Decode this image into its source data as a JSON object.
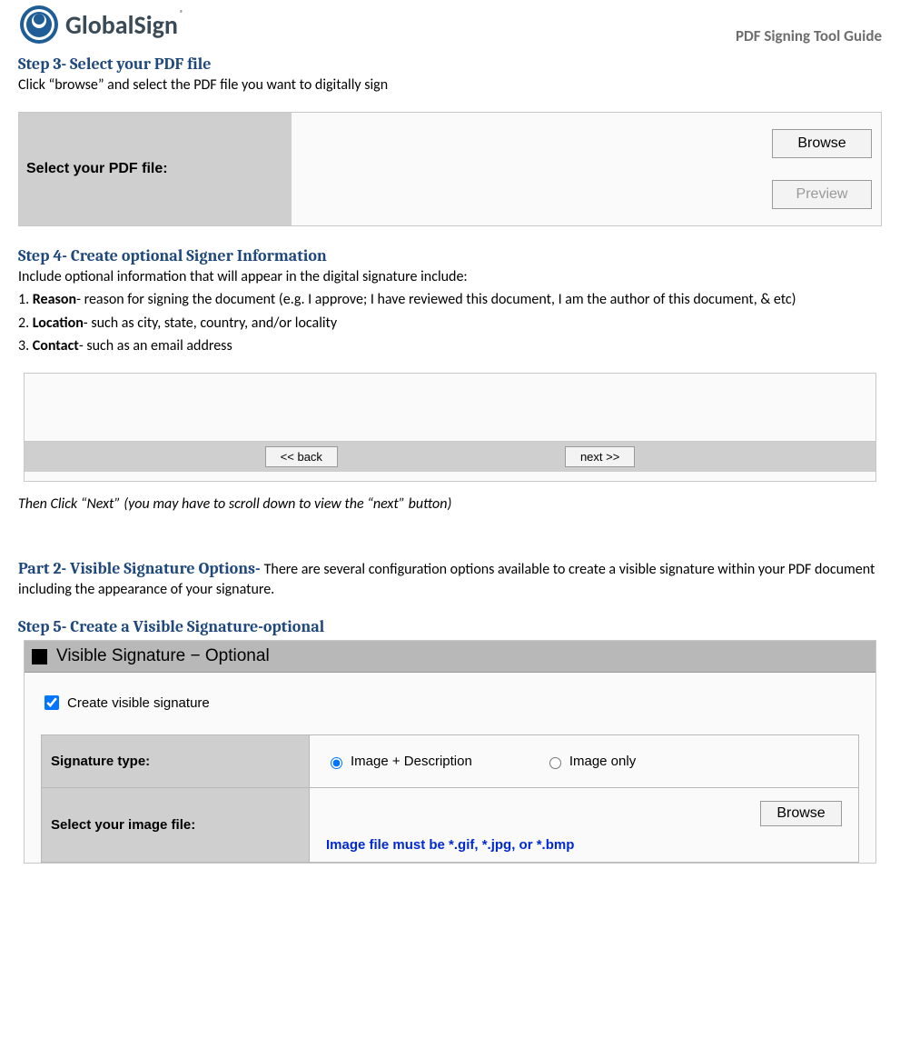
{
  "header": {
    "brand": "GlobalSign",
    "reg": "®",
    "guide_title": "PDF Signing Tool Guide"
  },
  "step3": {
    "title": "Step 3- Select your PDF file",
    "desc": "Click “browse” and select the PDF file you want to digitally sign",
    "panel": {
      "label": "Select your PDF file:",
      "browse": "Browse",
      "preview": "Preview"
    }
  },
  "step4": {
    "title": "Step 4- Create optional Signer Information",
    "intro": "Include optional information that will appear in the digital signature include:",
    "items": {
      "n1": "1. ",
      "k1": "Reason",
      "d1": "- reason for signing the document (e.g. I approve; I have reviewed this document, I am the author of this document, & etc)",
      "n2": "2. ",
      "k2": "Location",
      "d2": "- such as city, state, country, and/or locality",
      "n3": "3. ",
      "k3": "Contact",
      "d3": "- such as an email address"
    },
    "nav": {
      "back": "<< back",
      "next": "next >>"
    },
    "then": "Then Click “Next” (you may have to scroll down to view the “next” button)"
  },
  "part2": {
    "title": "Part 2- Visible Signature Options- ",
    "desc": "There are several configuration options available to create a visible signature within your PDF document including the appearance of your signature."
  },
  "step5": {
    "title": "Step 5- Create a Visible Signature-optional",
    "panel": {
      "header": " Visible Signature   −   Optional",
      "checkbox_label": "Create visible signature",
      "row_sig_type": "Signature type:",
      "opt1": "Image + Description",
      "opt2": "Image only",
      "row_img_file": "Select your image file:",
      "img_hint": "Image file must be *.gif, *.jpg, or *.bmp",
      "browse": "Browse"
    }
  }
}
